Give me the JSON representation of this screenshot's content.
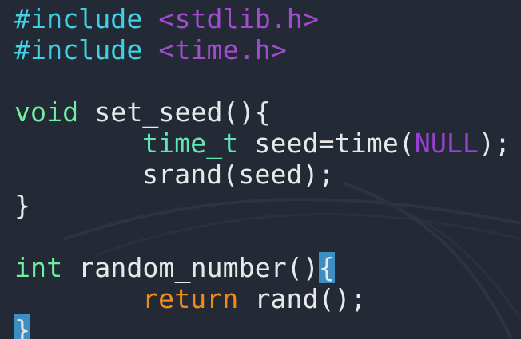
{
  "colors": {
    "background": "#232a35",
    "preprocessor": "#3fd0e4",
    "header": "#a04ccf",
    "type": "#6ff0a2",
    "text": "#e8e8e8",
    "constant": "#9a3fd6",
    "keyword": "#f08a1c",
    "bracket_highlight": "#3d8ec4"
  },
  "code": {
    "line1": {
      "directive": "#include",
      "space": " ",
      "header": "<stdlib.h>"
    },
    "line2": {
      "directive": "#include",
      "space": " ",
      "header": "<time.h>"
    },
    "line4": {
      "type": "void",
      "rest": " set_seed(){"
    },
    "line5": {
      "type": "time_t",
      "rest1": " seed=time(",
      "constant": "NULL",
      "rest2": ");"
    },
    "line6": {
      "text": "srand(seed);"
    },
    "line7": {
      "text": "}"
    },
    "line9": {
      "type": "int",
      "rest": " random_number()",
      "brace": "{"
    },
    "line10": {
      "keyword": "return",
      "rest": " rand();"
    },
    "line11": {
      "brace": "}"
    }
  }
}
